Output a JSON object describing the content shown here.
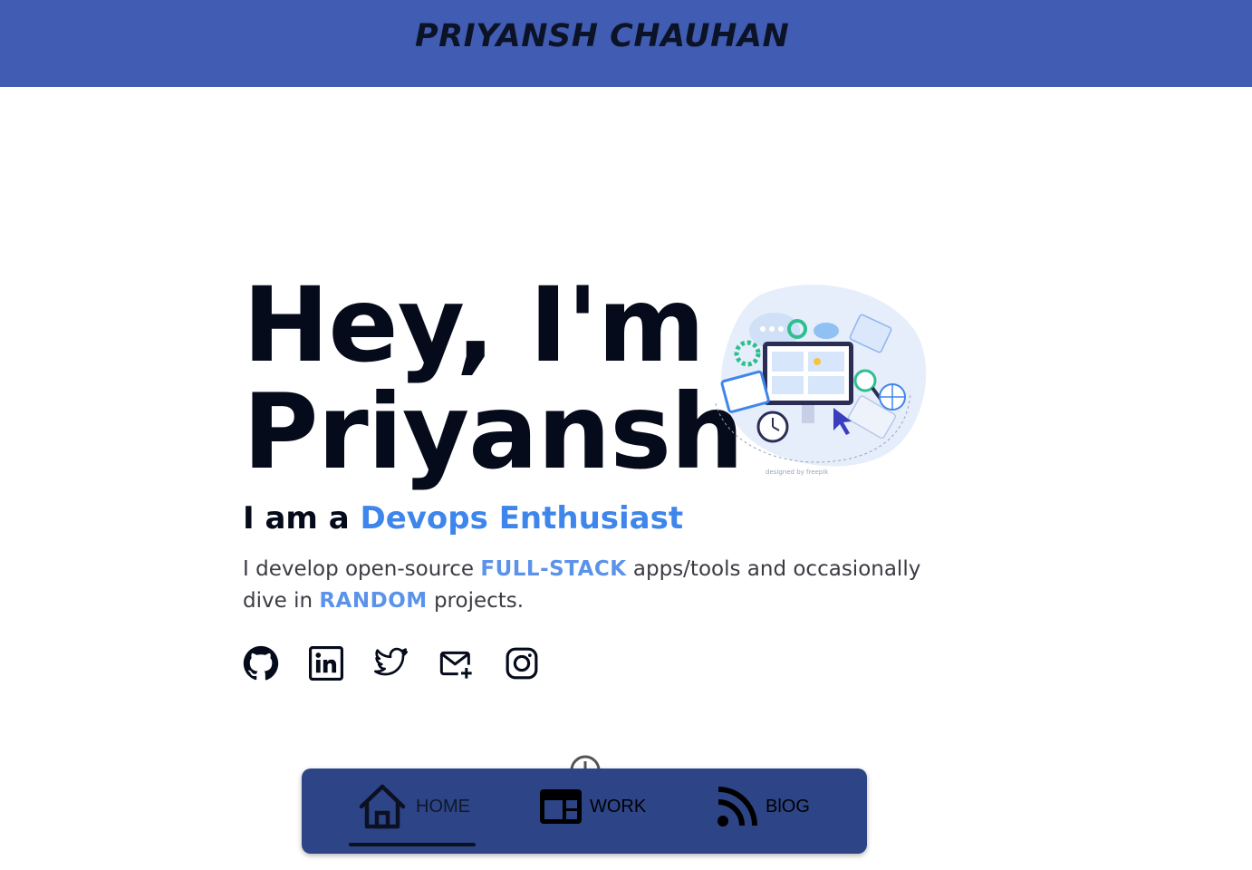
{
  "header": {
    "title": "PRIYANSH CHAUHAN"
  },
  "hero": {
    "title_line1": "Hey, I'm",
    "title_line2": "Priyansh",
    "subtitle_prefix": "I am a ",
    "subtitle_role": "Devops Enthusiast",
    "bio": {
      "part1": "I develop open-source ",
      "highlight1": "FULL-STACK",
      "part2": " apps/tools and occasionally dive in ",
      "highlight2": "RANDOM",
      "part3": " projects."
    },
    "illustration_credit": "designed by freepik"
  },
  "socials": [
    {
      "icon": "github-icon"
    },
    {
      "icon": "linkedin-icon"
    },
    {
      "icon": "twitter-icon"
    },
    {
      "icon": "mail-plus-icon"
    },
    {
      "icon": "instagram-icon"
    }
  ],
  "bottom_nav": {
    "items": [
      {
        "label": "HOME",
        "icon": "home-icon",
        "active": true
      },
      {
        "label": "WORK",
        "icon": "web-layout-icon",
        "active": false
      },
      {
        "label": "BlOG",
        "icon": "rss-icon",
        "active": false
      }
    ]
  },
  "colors": {
    "header_bg": "#405db3",
    "accent": "#3f86ec",
    "nav_bg": "#2d4486",
    "text_dark": "#050b1a"
  }
}
